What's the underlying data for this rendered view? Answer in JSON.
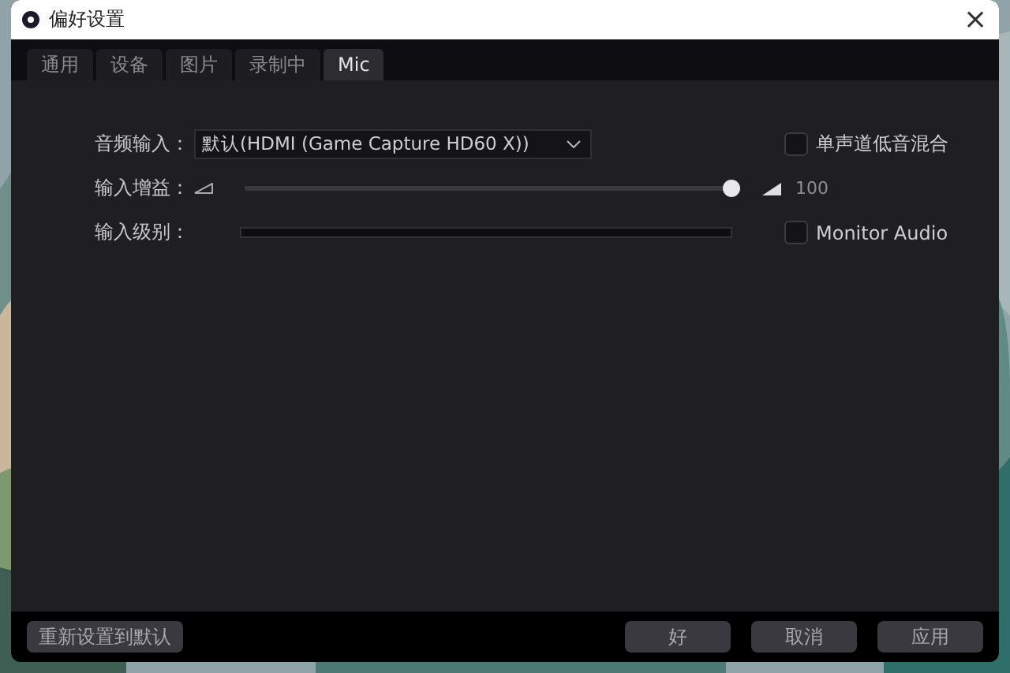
{
  "window": {
    "title": "偏好设置",
    "close": "×"
  },
  "tabs": [
    {
      "label": "通用",
      "selected": false
    },
    {
      "label": "设备",
      "selected": false
    },
    {
      "label": "图片",
      "selected": false
    },
    {
      "label": "录制中",
      "selected": false
    },
    {
      "label": "Mic",
      "selected": true
    }
  ],
  "audio_input": {
    "label": "音频输入：",
    "value": "默认(HDMI (Game Capture HD60 X))"
  },
  "mono_mix": {
    "label": "单声道低音混合",
    "checked": false
  },
  "gain": {
    "label": "输入增益：",
    "level": 1,
    "reading": "100"
  },
  "input_level": {
    "label": "输入级别：",
    "level": 0
  },
  "monitor_audio": {
    "label": "Monitor Audio",
    "checked": false
  },
  "buttons": [
    {
      "label": "重新设置到默认",
      "kind": "left"
    },
    {
      "label": "好",
      "kind": "right"
    },
    {
      "label": "取消",
      "kind": "right"
    },
    {
      "label": "应用",
      "kind": "right"
    }
  ]
}
